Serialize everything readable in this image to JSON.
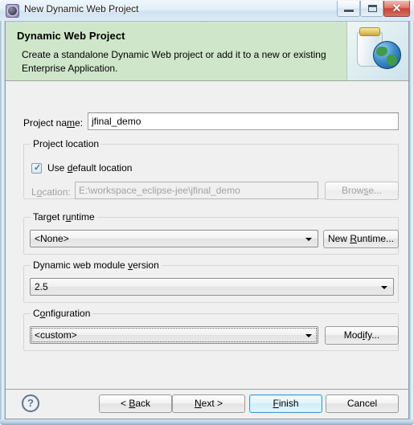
{
  "window": {
    "title": "New Dynamic Web Project",
    "icon": "eclipse-wizard-icon",
    "minimize_tooltip": "Minimize",
    "maximize_tooltip": "Maximize",
    "close_glyph": "✕"
  },
  "banner": {
    "title": "Dynamic Web Project",
    "description": "Create a standalone Dynamic Web project or add it to a new or existing Enterprise Application.",
    "image": "jar-with-globe-icon",
    "background": "#cfe6cb"
  },
  "form": {
    "project_name": {
      "label_before": "Project na",
      "label_mnemonic": "m",
      "label_after": "e:",
      "value": "jfinal_demo"
    },
    "project_location": {
      "group_title": "Project location",
      "use_default": {
        "label_before": "Use ",
        "label_mnemonic": "d",
        "label_after": "efault location",
        "checked": true,
        "check_glyph": "✓"
      },
      "location": {
        "label_before": "L",
        "label_mnemonic": "o",
        "label_after": "cation:",
        "value": "E:\\workspace_eclipse-jee\\jfinal_demo",
        "enabled": false
      },
      "browse_button": {
        "label_before": "Brow",
        "label_mnemonic": "s",
        "label_after": "e...",
        "enabled": false
      }
    },
    "target_runtime": {
      "group_title_before": "Target r",
      "group_title_mnemonic": "u",
      "group_title_after": "ntime",
      "selected": "<None>",
      "new_runtime_button_before": "New ",
      "new_runtime_button_mnemonic": "R",
      "new_runtime_button_after": "untime..."
    },
    "module_version": {
      "group_title_before": "Dynamic web module ",
      "group_title_mnemonic": "v",
      "group_title_after": "ersion",
      "selected": "2.5"
    },
    "configuration": {
      "group_title_before": "C",
      "group_title_mnemonic": "o",
      "group_title_after": "nfiguration",
      "selected": "<custom>",
      "focused": true,
      "modify_button_before": "Mod",
      "modify_button_mnemonic": "i",
      "modify_button_after": "fy..."
    }
  },
  "footer": {
    "help_glyph": "?",
    "back_before": "< ",
    "back_mnemonic": "B",
    "back_after": "ack",
    "next_before": "",
    "next_mnemonic": "N",
    "next_after": "ext >",
    "finish_before": "",
    "finish_mnemonic": "F",
    "finish_after": "inish",
    "cancel": "Cancel"
  },
  "colors": {
    "banner_green": "#cfe6cb",
    "dialog_gray": "#f0f0f0",
    "default_button_blue": "#3c9ad6",
    "close_button_red": "#c4463a"
  }
}
